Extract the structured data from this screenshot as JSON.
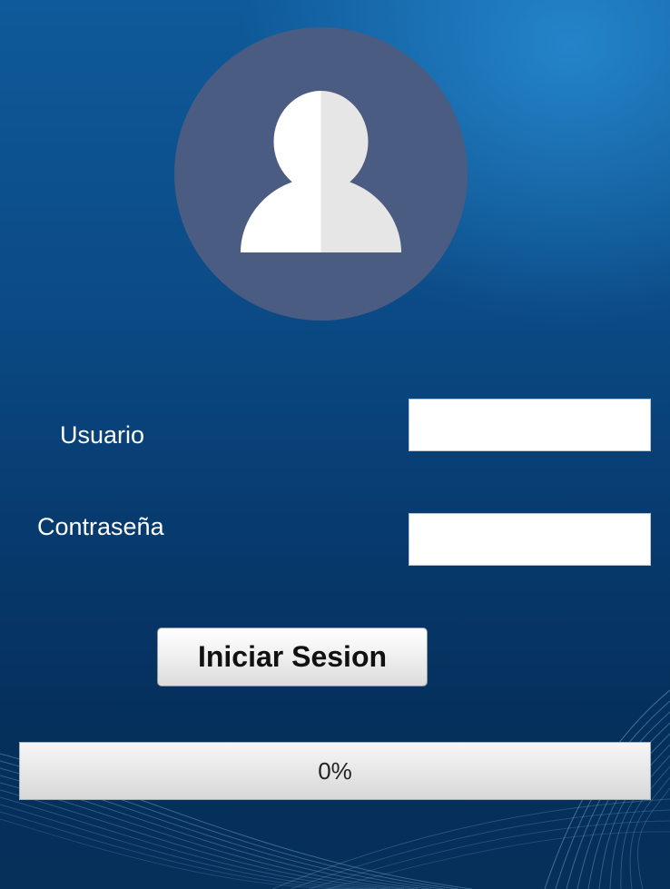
{
  "login": {
    "username_label": "Usuario",
    "password_label": "Contraseña",
    "username_value": "",
    "password_value": "",
    "submit_label": "Iniciar Sesion"
  },
  "progress": {
    "value_fraction": 0,
    "text": "0%"
  },
  "icons": {
    "avatar": "user-avatar-icon"
  },
  "colors": {
    "background_top": "#0f5a9a",
    "background_bottom": "#062f5a",
    "avatar_circle": "#4a5c82",
    "avatar_figure_light": "#ffffff",
    "avatar_figure_shade": "#e6e6e6"
  }
}
